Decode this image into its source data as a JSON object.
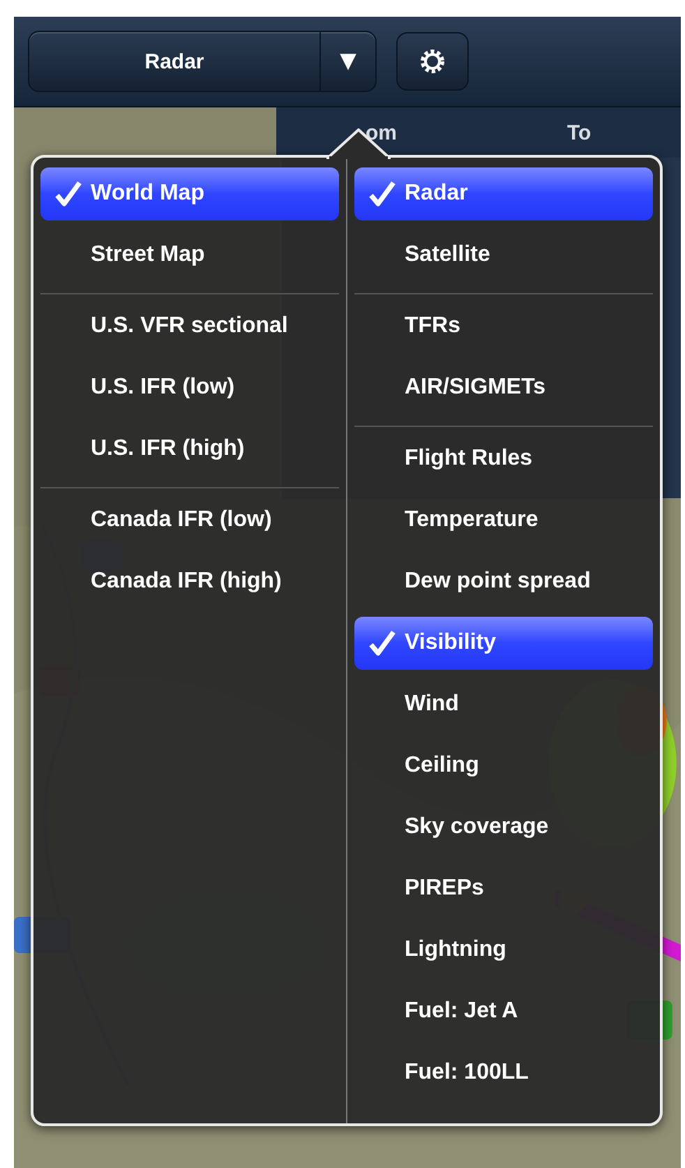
{
  "toolbar": {
    "layer_button": {
      "label": "Radar"
    },
    "dropdown_button": {
      "label": "▼"
    }
  },
  "route_header": {
    "from_label": "om",
    "to_label": "To"
  },
  "menu": {
    "columns": [
      {
        "sections": [
          {
            "items": [
              {
                "label": "World Map",
                "selected": true
              },
              {
                "label": "Street Map",
                "selected": false
              }
            ]
          },
          {
            "items": [
              {
                "label": "U.S. VFR sectional",
                "selected": false
              },
              {
                "label": "U.S. IFR (low)",
                "selected": false
              },
              {
                "label": "U.S. IFR (high)",
                "selected": false
              }
            ]
          },
          {
            "items": [
              {
                "label": "Canada IFR (low)",
                "selected": false
              },
              {
                "label": "Canada IFR (high)",
                "selected": false
              }
            ]
          }
        ]
      },
      {
        "sections": [
          {
            "items": [
              {
                "label": "Radar",
                "selected": true
              },
              {
                "label": "Satellite",
                "selected": false
              }
            ]
          },
          {
            "items": [
              {
                "label": "TFRs",
                "selected": false
              },
              {
                "label": "AIR/SIGMETs",
                "selected": false
              }
            ]
          },
          {
            "items": [
              {
                "label": "Flight Rules",
                "selected": false
              },
              {
                "label": "Temperature",
                "selected": false
              },
              {
                "label": "Dew point spread",
                "selected": false
              },
              {
                "label": "Visibility",
                "selected": true
              },
              {
                "label": "Wind",
                "selected": false
              },
              {
                "label": "Ceiling",
                "selected": false
              },
              {
                "label": "Sky coverage",
                "selected": false
              },
              {
                "label": "PIREPs",
                "selected": false
              },
              {
                "label": "Lightning",
                "selected": false
              },
              {
                "label": "Fuel: Jet A",
                "selected": false
              },
              {
                "label": "Fuel: 100LL",
                "selected": false
              }
            ]
          }
        ]
      }
    ]
  }
}
